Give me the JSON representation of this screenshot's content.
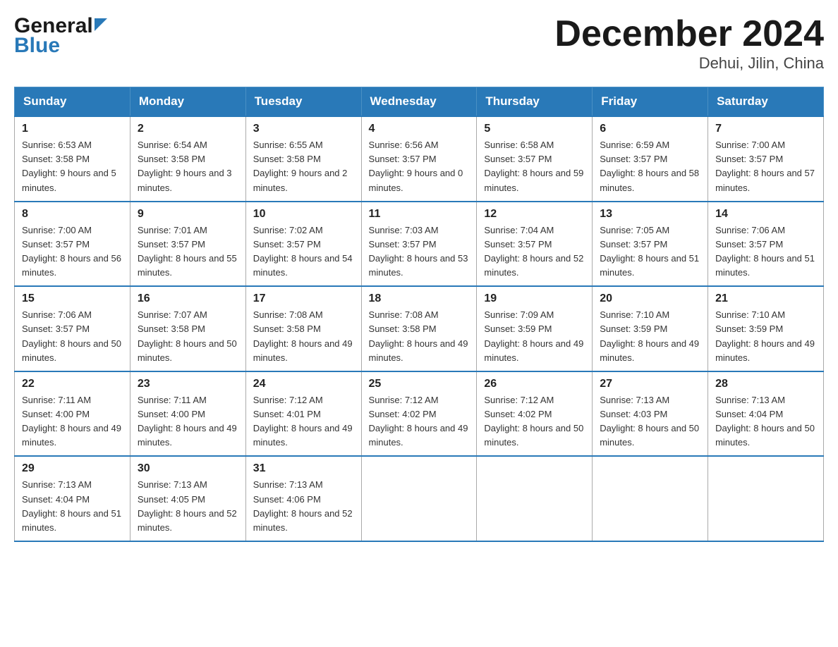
{
  "header": {
    "logo_general": "General",
    "logo_blue": "Blue",
    "month_title": "December 2024",
    "location": "Dehui, Jilin, China"
  },
  "weekdays": [
    "Sunday",
    "Monday",
    "Tuesday",
    "Wednesday",
    "Thursday",
    "Friday",
    "Saturday"
  ],
  "weeks": [
    [
      {
        "day": "1",
        "sunrise": "Sunrise: 6:53 AM",
        "sunset": "Sunset: 3:58 PM",
        "daylight": "Daylight: 9 hours and 5 minutes."
      },
      {
        "day": "2",
        "sunrise": "Sunrise: 6:54 AM",
        "sunset": "Sunset: 3:58 PM",
        "daylight": "Daylight: 9 hours and 3 minutes."
      },
      {
        "day": "3",
        "sunrise": "Sunrise: 6:55 AM",
        "sunset": "Sunset: 3:58 PM",
        "daylight": "Daylight: 9 hours and 2 minutes."
      },
      {
        "day": "4",
        "sunrise": "Sunrise: 6:56 AM",
        "sunset": "Sunset: 3:57 PM",
        "daylight": "Daylight: 9 hours and 0 minutes."
      },
      {
        "day": "5",
        "sunrise": "Sunrise: 6:58 AM",
        "sunset": "Sunset: 3:57 PM",
        "daylight": "Daylight: 8 hours and 59 minutes."
      },
      {
        "day": "6",
        "sunrise": "Sunrise: 6:59 AM",
        "sunset": "Sunset: 3:57 PM",
        "daylight": "Daylight: 8 hours and 58 minutes."
      },
      {
        "day": "7",
        "sunrise": "Sunrise: 7:00 AM",
        "sunset": "Sunset: 3:57 PM",
        "daylight": "Daylight: 8 hours and 57 minutes."
      }
    ],
    [
      {
        "day": "8",
        "sunrise": "Sunrise: 7:00 AM",
        "sunset": "Sunset: 3:57 PM",
        "daylight": "Daylight: 8 hours and 56 minutes."
      },
      {
        "day": "9",
        "sunrise": "Sunrise: 7:01 AM",
        "sunset": "Sunset: 3:57 PM",
        "daylight": "Daylight: 8 hours and 55 minutes."
      },
      {
        "day": "10",
        "sunrise": "Sunrise: 7:02 AM",
        "sunset": "Sunset: 3:57 PM",
        "daylight": "Daylight: 8 hours and 54 minutes."
      },
      {
        "day": "11",
        "sunrise": "Sunrise: 7:03 AM",
        "sunset": "Sunset: 3:57 PM",
        "daylight": "Daylight: 8 hours and 53 minutes."
      },
      {
        "day": "12",
        "sunrise": "Sunrise: 7:04 AM",
        "sunset": "Sunset: 3:57 PM",
        "daylight": "Daylight: 8 hours and 52 minutes."
      },
      {
        "day": "13",
        "sunrise": "Sunrise: 7:05 AM",
        "sunset": "Sunset: 3:57 PM",
        "daylight": "Daylight: 8 hours and 51 minutes."
      },
      {
        "day": "14",
        "sunrise": "Sunrise: 7:06 AM",
        "sunset": "Sunset: 3:57 PM",
        "daylight": "Daylight: 8 hours and 51 minutes."
      }
    ],
    [
      {
        "day": "15",
        "sunrise": "Sunrise: 7:06 AM",
        "sunset": "Sunset: 3:57 PM",
        "daylight": "Daylight: 8 hours and 50 minutes."
      },
      {
        "day": "16",
        "sunrise": "Sunrise: 7:07 AM",
        "sunset": "Sunset: 3:58 PM",
        "daylight": "Daylight: 8 hours and 50 minutes."
      },
      {
        "day": "17",
        "sunrise": "Sunrise: 7:08 AM",
        "sunset": "Sunset: 3:58 PM",
        "daylight": "Daylight: 8 hours and 49 minutes."
      },
      {
        "day": "18",
        "sunrise": "Sunrise: 7:08 AM",
        "sunset": "Sunset: 3:58 PM",
        "daylight": "Daylight: 8 hours and 49 minutes."
      },
      {
        "day": "19",
        "sunrise": "Sunrise: 7:09 AM",
        "sunset": "Sunset: 3:59 PM",
        "daylight": "Daylight: 8 hours and 49 minutes."
      },
      {
        "day": "20",
        "sunrise": "Sunrise: 7:10 AM",
        "sunset": "Sunset: 3:59 PM",
        "daylight": "Daylight: 8 hours and 49 minutes."
      },
      {
        "day": "21",
        "sunrise": "Sunrise: 7:10 AM",
        "sunset": "Sunset: 3:59 PM",
        "daylight": "Daylight: 8 hours and 49 minutes."
      }
    ],
    [
      {
        "day": "22",
        "sunrise": "Sunrise: 7:11 AM",
        "sunset": "Sunset: 4:00 PM",
        "daylight": "Daylight: 8 hours and 49 minutes."
      },
      {
        "day": "23",
        "sunrise": "Sunrise: 7:11 AM",
        "sunset": "Sunset: 4:00 PM",
        "daylight": "Daylight: 8 hours and 49 minutes."
      },
      {
        "day": "24",
        "sunrise": "Sunrise: 7:12 AM",
        "sunset": "Sunset: 4:01 PM",
        "daylight": "Daylight: 8 hours and 49 minutes."
      },
      {
        "day": "25",
        "sunrise": "Sunrise: 7:12 AM",
        "sunset": "Sunset: 4:02 PM",
        "daylight": "Daylight: 8 hours and 49 minutes."
      },
      {
        "day": "26",
        "sunrise": "Sunrise: 7:12 AM",
        "sunset": "Sunset: 4:02 PM",
        "daylight": "Daylight: 8 hours and 50 minutes."
      },
      {
        "day": "27",
        "sunrise": "Sunrise: 7:13 AM",
        "sunset": "Sunset: 4:03 PM",
        "daylight": "Daylight: 8 hours and 50 minutes."
      },
      {
        "day": "28",
        "sunrise": "Sunrise: 7:13 AM",
        "sunset": "Sunset: 4:04 PM",
        "daylight": "Daylight: 8 hours and 50 minutes."
      }
    ],
    [
      {
        "day": "29",
        "sunrise": "Sunrise: 7:13 AM",
        "sunset": "Sunset: 4:04 PM",
        "daylight": "Daylight: 8 hours and 51 minutes."
      },
      {
        "day": "30",
        "sunrise": "Sunrise: 7:13 AM",
        "sunset": "Sunset: 4:05 PM",
        "daylight": "Daylight: 8 hours and 52 minutes."
      },
      {
        "day": "31",
        "sunrise": "Sunrise: 7:13 AM",
        "sunset": "Sunset: 4:06 PM",
        "daylight": "Daylight: 8 hours and 52 minutes."
      },
      null,
      null,
      null,
      null
    ]
  ]
}
